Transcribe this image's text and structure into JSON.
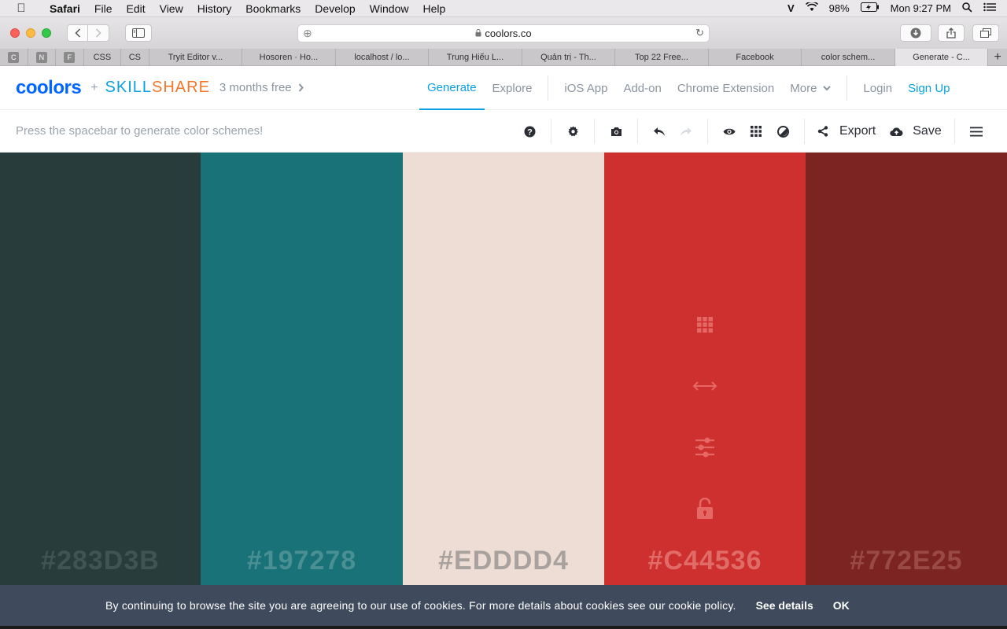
{
  "macos_menu": {
    "app": "Safari",
    "items": [
      "File",
      "Edit",
      "View",
      "History",
      "Bookmarks",
      "Develop",
      "Window",
      "Help"
    ],
    "status": {
      "user_initial": "V",
      "battery": "98%",
      "clock": "Mon 9:27 PM"
    }
  },
  "browser": {
    "url": "coolors.co",
    "pinned_tabs": [
      "C",
      "N",
      "F"
    ],
    "tabs": [
      {
        "label": "CSS",
        "active": false
      },
      {
        "label": "CS",
        "active": false
      },
      {
        "label": "Tryit Editor v...",
        "active": false
      },
      {
        "label": "Hosoren · Ho...",
        "active": false
      },
      {
        "label": "localhost / lo...",
        "active": false
      },
      {
        "label": "Trung Hiếu L...",
        "active": false
      },
      {
        "label": "Quản trị - Th...",
        "active": false
      },
      {
        "label": "Top 22 Free...",
        "active": false
      },
      {
        "label": "Facebook",
        "active": false
      },
      {
        "label": "color schem...",
        "active": false
      },
      {
        "label": "Generate - C...",
        "active": true
      }
    ]
  },
  "header": {
    "logo": "coolors",
    "plus": "+",
    "partner": "SKILLSHARE",
    "promo": "3 months free",
    "nav": {
      "generate": "Generate",
      "explore": "Explore",
      "ios_app": "iOS App",
      "addon": "Add-on",
      "chrome_ext": "Chrome Extension",
      "more": "More",
      "login": "Login",
      "signup": "Sign Up"
    }
  },
  "subbar": {
    "hint": "Press the spacebar to generate color schemes!",
    "export": "Export",
    "save": "Save"
  },
  "palette": {
    "colors": [
      {
        "hex": "#283D3B",
        "bg": "#283d3b",
        "text_color": "#3f5553"
      },
      {
        "hex": "#197278",
        "bg": "#197278",
        "text_color": "#4a8f93"
      },
      {
        "hex": "#EDDDD4",
        "bg": "#edddd4",
        "text_color": "#a8a19d"
      },
      {
        "hex": "#C44536",
        "bg": "#cd302e",
        "text_color": "#e06b67"
      },
      {
        "hex": "#772E25",
        "bg": "#7b2421",
        "text_color": "#9a4a46"
      }
    ],
    "hover_icon_color": "#e66865"
  },
  "cookie": {
    "message": "By continuing to browse the site you are agreeing to our use of cookies. For more details about cookies see our cookie policy.",
    "details": "See details",
    "ok": "OK"
  }
}
